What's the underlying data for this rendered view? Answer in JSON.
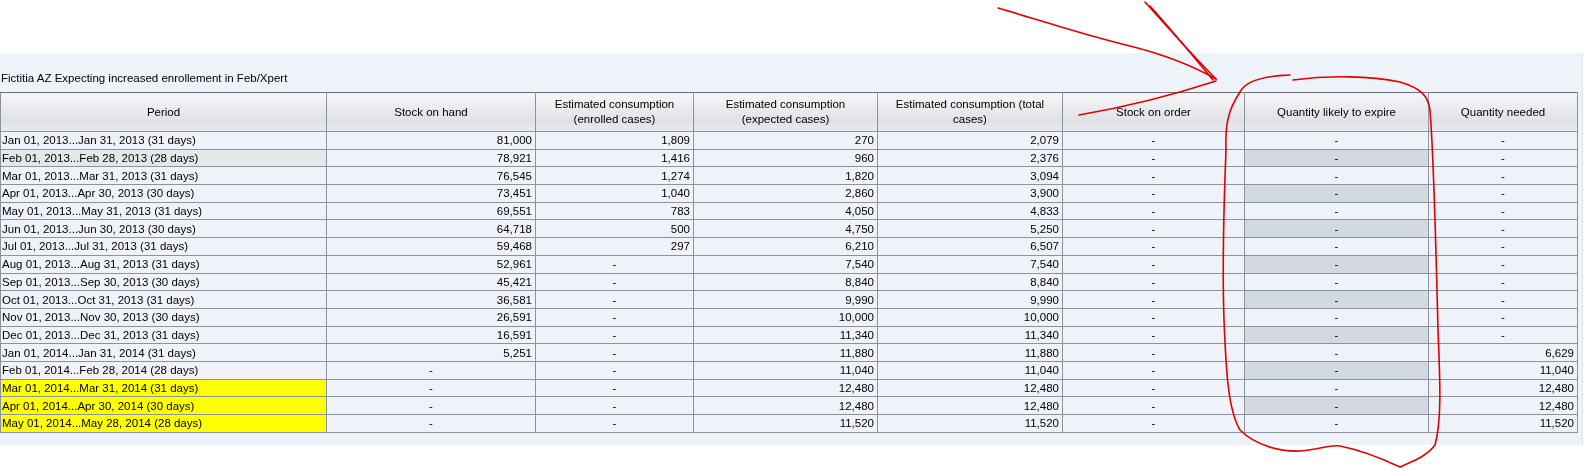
{
  "title": "Fictitia AZ Expecting increased enrollement in Feb/Xpert",
  "columns": [
    "Period",
    "Stock on hand",
    "Estimated consumption (enrolled cases)",
    "Estimated consumption (expected cases)",
    "Estimated consumption (total cases)",
    "Stock on order",
    "Quantity likely to expire",
    "Quantity needed"
  ],
  "rows": [
    {
      "period": "Jan 01, 2013...Jan 31, 2013 (31 days)",
      "values": [
        "81,000",
        "1,809",
        "270",
        "2,079",
        "-",
        "-",
        "-"
      ],
      "highlighted": false,
      "selected": false,
      "expire_shaded": false
    },
    {
      "period": "Feb 01, 2013...Feb 28, 2013 (28 days)",
      "values": [
        "78,921",
        "1,416",
        "960",
        "2,376",
        "-",
        "-",
        "-"
      ],
      "highlighted": false,
      "selected": true,
      "expire_shaded": true
    },
    {
      "period": "Mar 01, 2013...Mar 31, 2013 (31 days)",
      "values": [
        "76,545",
        "1,274",
        "1,820",
        "3,094",
        "-",
        "-",
        "-"
      ],
      "highlighted": false,
      "selected": false,
      "expire_shaded": false
    },
    {
      "period": "Apr 01, 2013...Apr 30, 2013 (30 days)",
      "values": [
        "73,451",
        "1,040",
        "2,860",
        "3,900",
        "-",
        "-",
        "-"
      ],
      "highlighted": false,
      "selected": false,
      "expire_shaded": true
    },
    {
      "period": "May 01, 2013...May 31, 2013 (31 days)",
      "values": [
        "69,551",
        "783",
        "4,050",
        "4,833",
        "-",
        "-",
        "-"
      ],
      "highlighted": false,
      "selected": false,
      "expire_shaded": false
    },
    {
      "period": "Jun 01, 2013...Jun 30, 2013 (30 days)",
      "values": [
        "64,718",
        "500",
        "4,750",
        "5,250",
        "-",
        "-",
        "-"
      ],
      "highlighted": false,
      "selected": false,
      "expire_shaded": true
    },
    {
      "period": "Jul 01, 2013...Jul 31, 2013 (31 days)",
      "values": [
        "59,468",
        "297",
        "6,210",
        "6,507",
        "-",
        "-",
        "-"
      ],
      "highlighted": false,
      "selected": false,
      "expire_shaded": false
    },
    {
      "period": "Aug 01, 2013...Aug 31, 2013 (31 days)",
      "values": [
        "52,961",
        "-",
        "7,540",
        "7,540",
        "-",
        "-",
        "-"
      ],
      "highlighted": false,
      "selected": false,
      "expire_shaded": true
    },
    {
      "period": "Sep 01, 2013...Sep 30, 2013 (30 days)",
      "values": [
        "45,421",
        "-",
        "8,840",
        "8,840",
        "-",
        "-",
        "-"
      ],
      "highlighted": false,
      "selected": false,
      "expire_shaded": false
    },
    {
      "period": "Oct 01, 2013...Oct 31, 2013 (31 days)",
      "values": [
        "36,581",
        "-",
        "9,990",
        "9,990",
        "-",
        "-",
        "-"
      ],
      "highlighted": false,
      "selected": false,
      "expire_shaded": true
    },
    {
      "period": "Nov 01, 2013...Nov 30, 2013 (30 days)",
      "values": [
        "26,591",
        "-",
        "10,000",
        "10,000",
        "-",
        "-",
        "-"
      ],
      "highlighted": false,
      "selected": false,
      "expire_shaded": false
    },
    {
      "period": "Dec 01, 2013...Dec 31, 2013 (31 days)",
      "values": [
        "16,591",
        "-",
        "11,340",
        "11,340",
        "-",
        "-",
        "-"
      ],
      "highlighted": false,
      "selected": false,
      "expire_shaded": true
    },
    {
      "period": "Jan 01, 2014...Jan 31, 2014 (31 days)",
      "values": [
        "5,251",
        "-",
        "11,880",
        "11,880",
        "-",
        "-",
        "6,629"
      ],
      "highlighted": false,
      "selected": false,
      "expire_shaded": false
    },
    {
      "period": "Feb 01, 2014...Feb 28, 2014 (28 days)",
      "values": [
        "-",
        "-",
        "11,040",
        "11,040",
        "-",
        "-",
        "11,040"
      ],
      "highlighted": false,
      "selected": false,
      "expire_shaded": true
    },
    {
      "period": "Mar 01, 2014...Mar 31, 2014 (31 days)",
      "values": [
        "-",
        "-",
        "12,480",
        "12,480",
        "-",
        "-",
        "12,480"
      ],
      "highlighted": true,
      "selected": false,
      "expire_shaded": false
    },
    {
      "period": "Apr 01, 2014...Apr 30, 2014 (30 days)",
      "values": [
        "-",
        "-",
        "12,480",
        "12,480",
        "-",
        "-",
        "12,480"
      ],
      "highlighted": true,
      "selected": false,
      "expire_shaded": true
    },
    {
      "period": "May 01, 2014...May 28, 2014 (28 days)",
      "values": [
        "-",
        "-",
        "11,520",
        "11,520",
        "-",
        "-",
        "11,520"
      ],
      "highlighted": true,
      "selected": false,
      "expire_shaded": false
    }
  ]
}
